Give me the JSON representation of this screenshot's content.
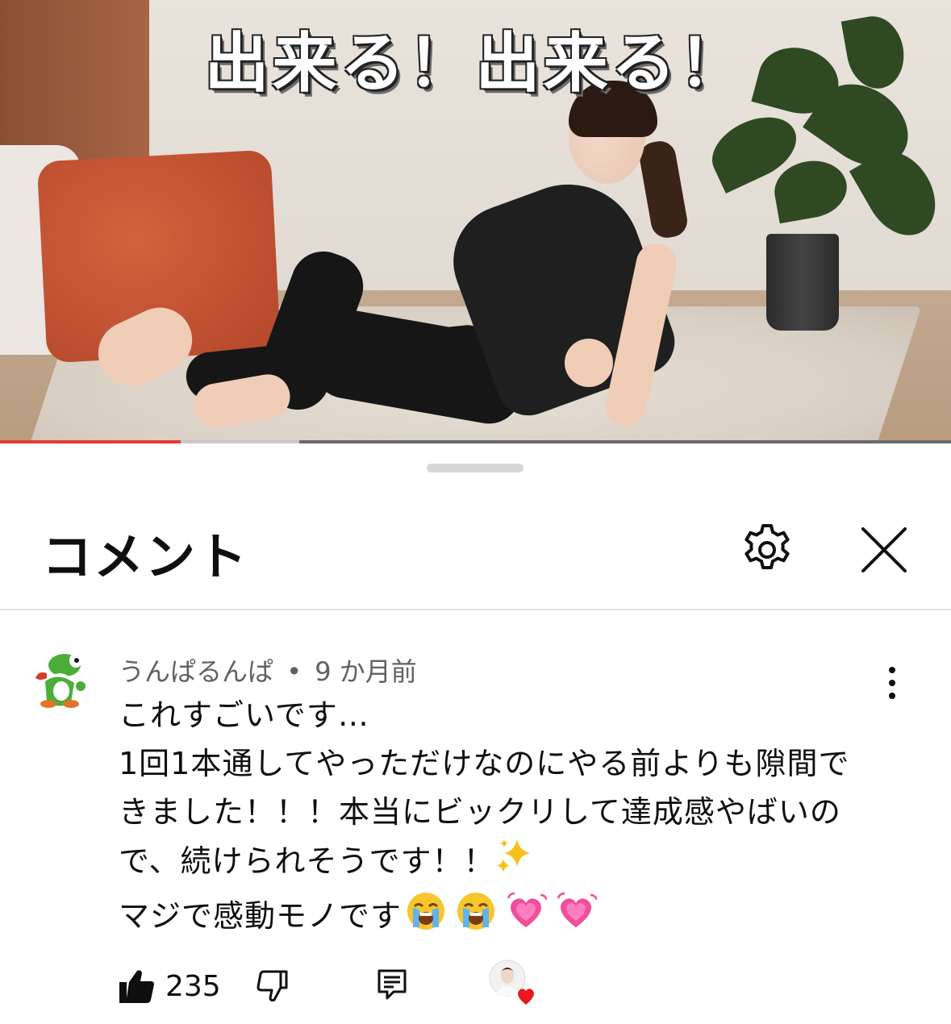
{
  "video": {
    "overlay_text": "出来る！出来る！",
    "progress": {
      "played": 0.19,
      "buffered": 0.315
    },
    "progress_colors": {
      "played": "#e53a2f",
      "buffered": "#c8c8c8",
      "track": "#6a6a6a"
    }
  },
  "sheet": {
    "title": "コメント",
    "settings_icon": "gear-icon",
    "close_icon": "close-icon"
  },
  "comment": {
    "author": "うんぱるんぱ",
    "separator": "•",
    "time": "9 か月前",
    "avatar_icon": "green-dinosaur-avatar",
    "lines": [
      "これすごいです…",
      "1回1本通してやっただけなのにやる前よりも隙間で",
      "きました！！！本当にビックリして達成感やばいの",
      "で、続けられそうです！！",
      "マジで感動モノです"
    ],
    "line4_emoji": [
      "sparkles-emoji"
    ],
    "line5_emojis": [
      "loudly-crying-face-emoji",
      "loudly-crying-face-emoji",
      "growing-heart-emoji",
      "growing-heart-emoji"
    ],
    "like_count": "235",
    "icons": {
      "like": "thumbs-up-icon",
      "dislike": "thumbs-down-icon",
      "reply": "reply-icon",
      "creator_heart": "creator-heart-icon"
    },
    "heart_color": "#e8191f"
  }
}
